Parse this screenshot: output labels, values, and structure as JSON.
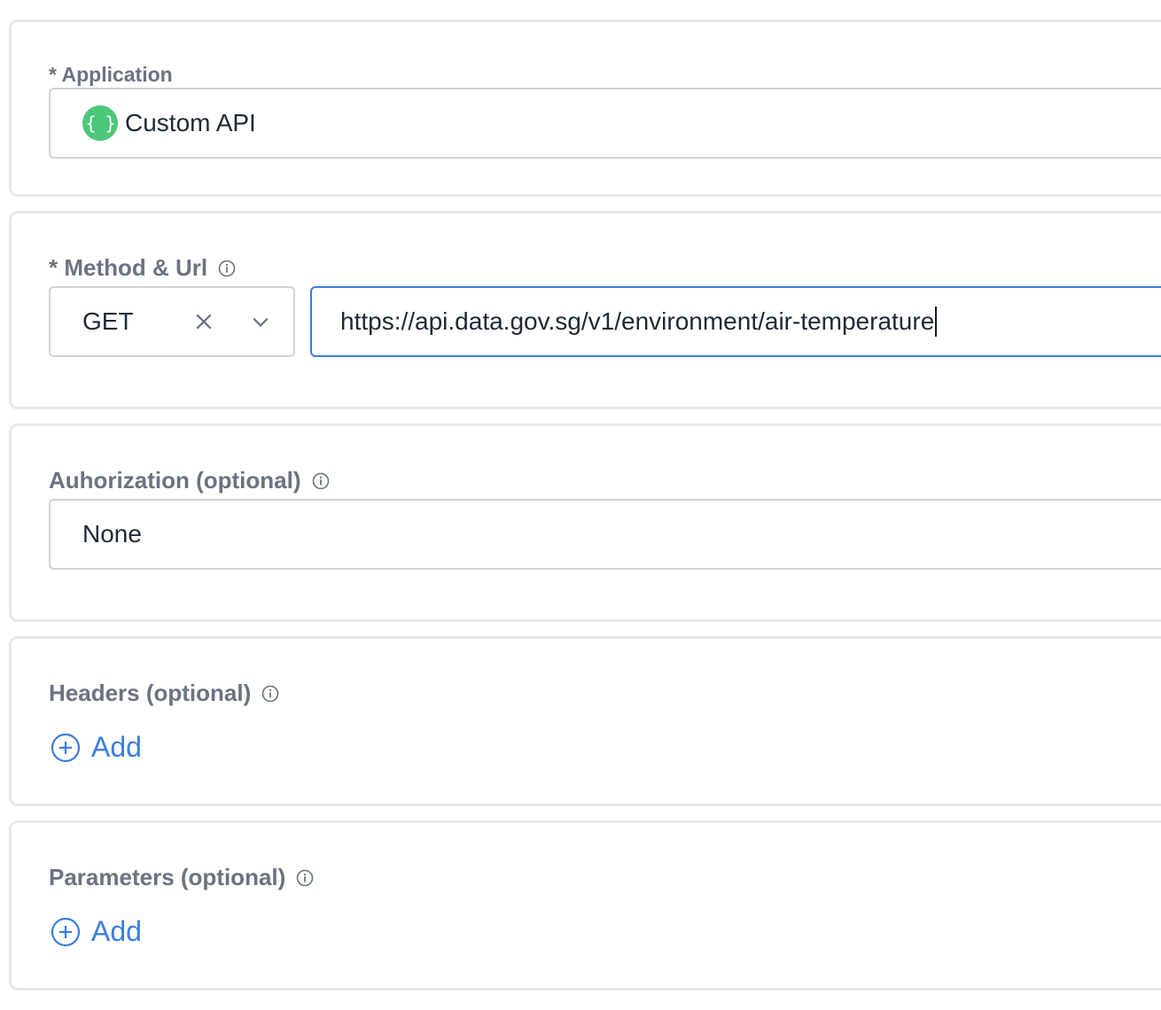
{
  "application": {
    "label": "* Application",
    "value": "Custom API",
    "icon": "custom-api-braces-icon",
    "icon_glyph": "{ }",
    "icon_color": "#4cc67a"
  },
  "method_url": {
    "label": "* Method & Url",
    "method": "GET",
    "url": "https://api.data.gov.sg/v1/environment/air-temperature",
    "focus_color": "#3b7de0"
  },
  "authorization": {
    "label": "Auhorization (optional)",
    "value": "None"
  },
  "headers": {
    "label": "Headers (optional)",
    "add_label": "Add"
  },
  "parameters": {
    "label": "Parameters (optional)",
    "add_label": "Add"
  },
  "colors": {
    "accent": "#3b7de0",
    "label_text": "#6b7280",
    "card_border": "#e6e7ea"
  }
}
